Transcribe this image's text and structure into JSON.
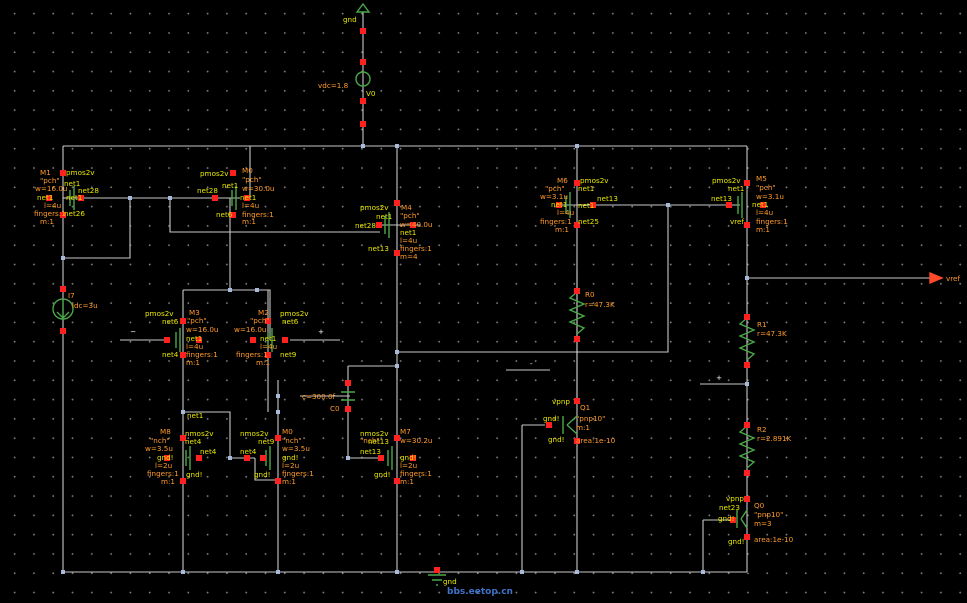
{
  "labels": {
    "gnd_top": "gnd",
    "vdc": "vdc=1.8",
    "v0": "V0",
    "net1_bottom": "net1",
    "minus_right": "-",
    "plus_right": "+",
    "vref_pin": "vref",
    "gnd_bottom": "gnd",
    "watermark": "bbs.eetop.cn"
  },
  "devices": {
    "m1": {
      "name": "M1",
      "model": "pmos2v",
      "pch": "\"pch\"",
      "net1": "net1",
      "w": "w=16.0u",
      "net28": "net28",
      "net1b": "net1",
      "net1c": "net1",
      "l": "l=4u",
      "fingers": "fingers:1",
      "net26": "net26",
      "m": "m:1"
    },
    "m0": {
      "model": "pmos2v",
      "name": "M0",
      "pch": "\"pch\"",
      "net1": "net1",
      "w": "w=30.0u",
      "net28": "net28",
      "net1b": "net1",
      "l": "l=4u",
      "net6": "net6",
      "fingers": "fingers:1",
      "m": "m:1"
    },
    "m4": {
      "model": "pmos2v",
      "name": "M4",
      "pch": "\"pch\"",
      "net1": "net1",
      "w": "w=40.0u",
      "net28": "net28",
      "net1b": "net1",
      "l": "l=4u",
      "fingers": "fingers:1",
      "net13": "net13",
      "m": "m=4"
    },
    "m6": {
      "name": "M6",
      "model": "pmos2v",
      "nch": "\"pch\"",
      "net1": "net1",
      "w": "w=3.1u",
      "net13": "net13",
      "net1b": "net1",
      "net1c": "net1",
      "l": "l=4u",
      "fingers": "fingers:1",
      "net25": "net25",
      "m": "m:1"
    },
    "m5": {
      "model": "pmos2v",
      "name": "M5",
      "net1": "net1",
      "nch": "\"pch\"",
      "w": "w=3.1u",
      "net13": "net13",
      "net1b": "net1",
      "l": "l=4u",
      "fingers": "fingers:1",
      "vref": "vref",
      "m": "m:1"
    },
    "i7": {
      "name": "I7",
      "idc": "idc=3u"
    },
    "m3": {
      "model": "pmos2v",
      "name": "M3",
      "net6": "net6",
      "pch": "\"pch\"",
      "w": "w=16.0u",
      "minus": "−",
      "net1": "net1",
      "l": "l=4u",
      "net4": "net4",
      "fingers": "fingers:1",
      "m": "m:1"
    },
    "m2": {
      "name": "M2",
      "model": "pmos2v",
      "pch": "\"pch\"",
      "net6": "net6",
      "w": "w=16.0u",
      "plus": "+",
      "net1": "net1",
      "l": "l=4u",
      "fingers": "fingers:1",
      "net9": "net9",
      "m": "m:1"
    },
    "c0": {
      "value": "c=300.0f",
      "name": "C0"
    },
    "m8": {
      "name": "M8",
      "model": "nmos2v",
      "nch": "\"nch\"",
      "net4": "net4",
      "w": "w=3.5u",
      "net4b": "net4",
      "gnd": "gnd!",
      "l": "l=2u",
      "fingers": "fingers:1",
      "gndb": "gnd!",
      "m": "m:1"
    },
    "m0b": {
      "model": "nmos2v",
      "name": "M0",
      "nch": "\"nch\"",
      "net9": "net9",
      "w": "w=3.5u",
      "net4": "net4",
      "gnd": "gnd!",
      "l": "l=2u",
      "fingers": "fingers:1",
      "gndb": "gnd!",
      "m": "m:1"
    },
    "m7": {
      "model": "nmos2v",
      "name": "M7",
      "nch": "\"nch\"",
      "w": "w=30.2u",
      "net13": "net13",
      "net13b": "net13",
      "gnd": "gnd!",
      "l": "l=2u",
      "fingers": "fingers:1",
      "gndb": "gnd!",
      "m": "m:1"
    },
    "r0": {
      "name": "R0",
      "value": "r=47.3K"
    },
    "q1": {
      "model": "vpnp",
      "name": "Q1",
      "pnp": "\"pnp10\"",
      "gnd": "gnd!",
      "m": "m:1",
      "gndb": "gnd!",
      "area": "area:1e-10"
    },
    "r1": {
      "name": "R1",
      "value": "r=47.3K"
    },
    "r2": {
      "name": "R2",
      "value": "r=2.891K"
    },
    "q0": {
      "model": "vpnp",
      "name": "Q0",
      "net23": "net23",
      "pnp": "\"pnp10\"",
      "gnd": "gnd!",
      "m": "m=3",
      "gndb": "gnd!",
      "area": "area:1e-10"
    }
  },
  "colors": {
    "wire": "#c8c8c8",
    "pin": "#ff2020",
    "device": "#4aa848",
    "instance_label": "#ff9a2a",
    "net_label": "#e8e800",
    "background": "#000000"
  }
}
